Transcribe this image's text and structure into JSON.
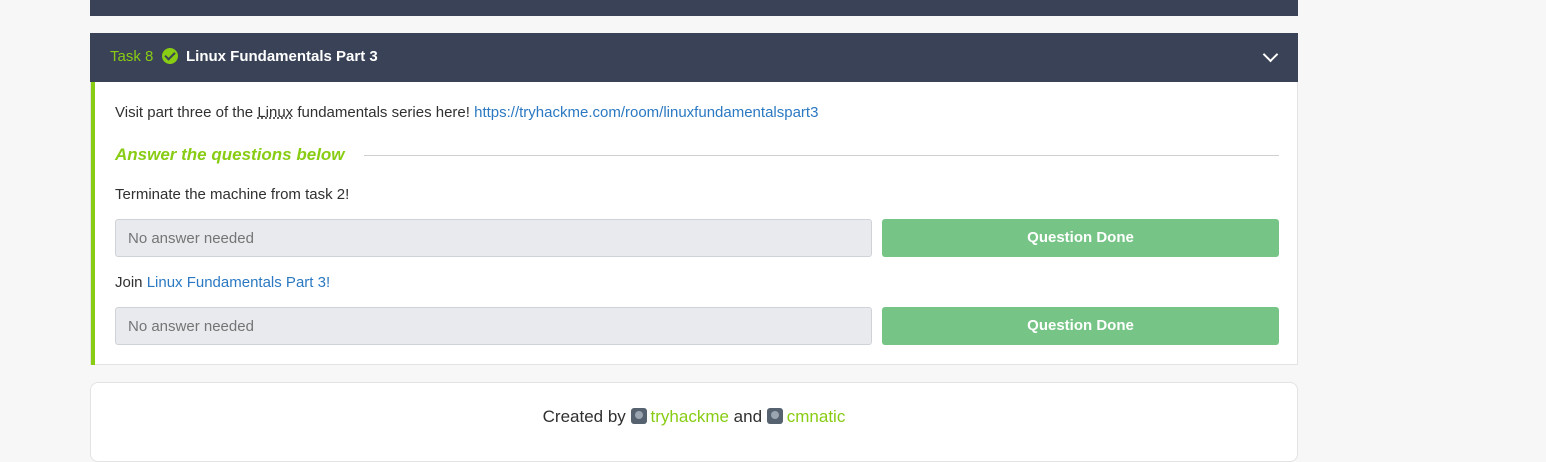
{
  "task": {
    "number_label": "Task 8",
    "title": "Linux Fundamentals Part 3",
    "intro_prefix": "Visit part three of the ",
    "intro_abbr": "Linux",
    "intro_suffix": " fundamentals series here! ",
    "intro_link": "https://tryhackme.com/room/linuxfundamentalspart3",
    "answer_heading": "Answer the questions below",
    "questions": [
      {
        "text": "Terminate the machine from task 2!",
        "answer_placeholder": "No answer needed",
        "button_label": "Question Done"
      },
      {
        "text_prefix": "Join ",
        "text_link": "Linux Fundamentals Part 3!",
        "answer_placeholder": "No answer needed",
        "button_label": "Question Done"
      }
    ]
  },
  "footer": {
    "created_by": "Created by ",
    "author1": "tryhackme",
    "and": " and ",
    "author2": "cmnatic"
  },
  "colors": {
    "header_bg": "#394256",
    "accent_green": "#88cc14",
    "button_green": "#77c586",
    "link_blue": "#2b79c2"
  },
  "icons": {
    "completed": "check-circle-icon",
    "collapse": "chevron-down-icon",
    "author_avatars": [
      "tryhackme-avatar-icon",
      "cmnatic-avatar-icon"
    ]
  }
}
